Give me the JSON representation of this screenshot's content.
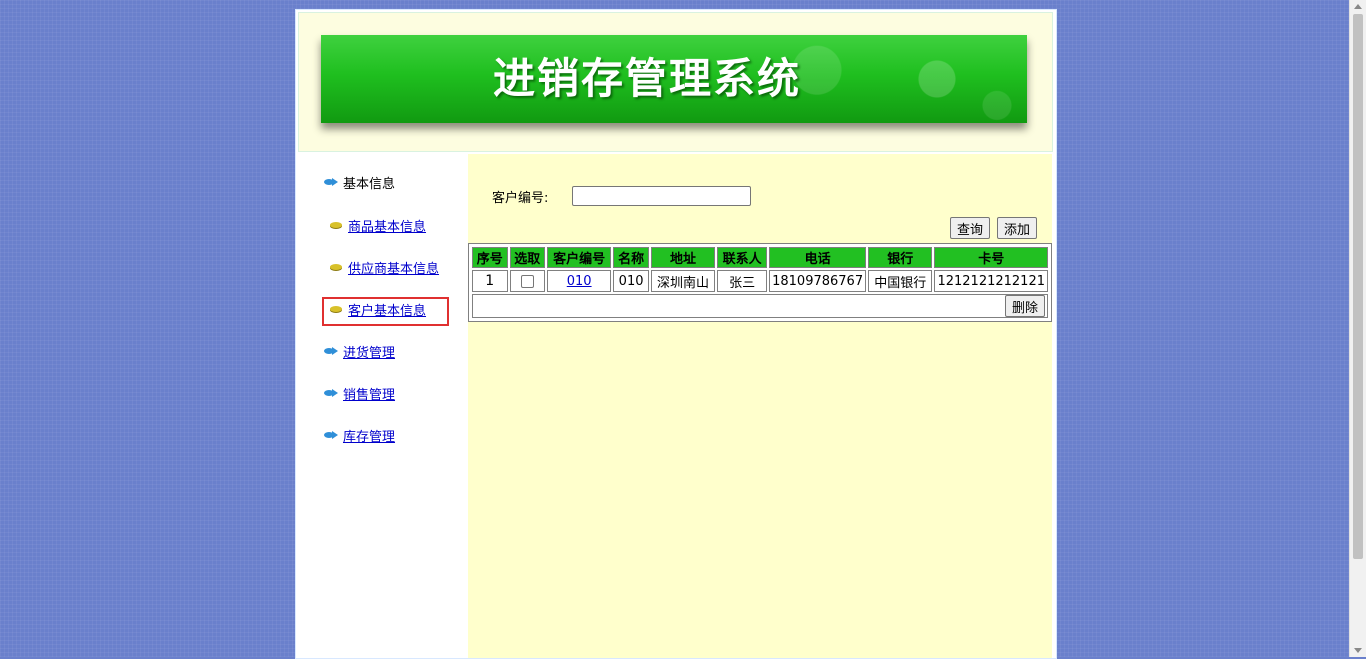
{
  "app": {
    "title": "进销存管理系统"
  },
  "sidebar": {
    "section_basic": "基本信息",
    "items": [
      {
        "label": "商品基本信息"
      },
      {
        "label": "供应商基本信息"
      },
      {
        "label": "客户基本信息"
      }
    ],
    "section_purchase": "进货管理",
    "section_sales": "销售管理",
    "section_stock": "库存管理"
  },
  "search": {
    "label": "客户编号:",
    "value": "",
    "query_label": "查询",
    "add_label": "添加"
  },
  "table": {
    "headers": [
      "序号",
      "选取",
      "客户编号",
      "名称",
      "地址",
      "联系人",
      "电话",
      "银行",
      "卡号"
    ],
    "rows": [
      {
        "index": "1",
        "code": "010",
        "name": "010",
        "address": "深圳南山",
        "contact": "张三",
        "phone": "18109786767",
        "bank": "中国银行",
        "card": "1212121212121"
      }
    ],
    "delete_label": "删除"
  },
  "colors": {
    "background": "#6a80cc",
    "banner_green": "#1fbf1f",
    "header_green": "#22c022",
    "content_bg": "#ffffcc",
    "selected_outline": "#e03030"
  }
}
